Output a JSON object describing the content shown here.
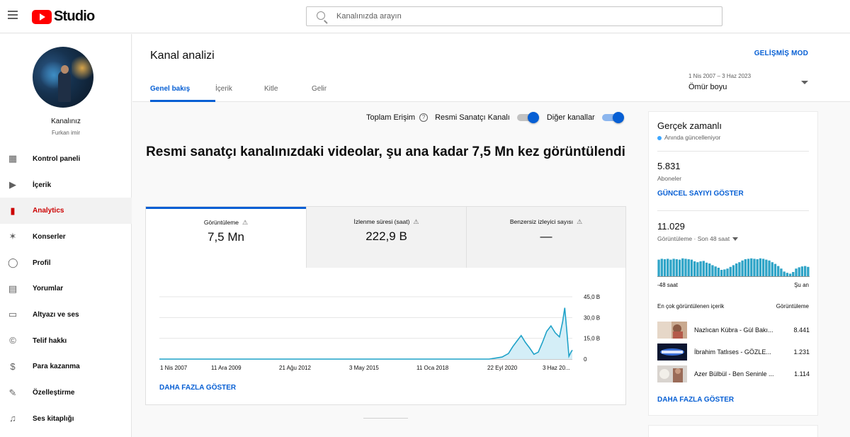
{
  "header": {
    "logo_text": "Studio",
    "search_placeholder": "Kanalınızda arayın"
  },
  "sidebar": {
    "channel_label": "Kanalınız",
    "channel_name": "Furkan imir",
    "items": [
      {
        "label": "Kontrol paneli",
        "icon": "dashboard-icon",
        "glyph": "▦"
      },
      {
        "label": "İçerik",
        "icon": "content-icon",
        "glyph": "▶"
      },
      {
        "label": "Analytics",
        "icon": "analytics-icon",
        "glyph": "▮"
      },
      {
        "label": "Konserler",
        "icon": "concerts-icon",
        "glyph": "✶"
      },
      {
        "label": "Profil",
        "icon": "profile-icon",
        "glyph": "◯"
      },
      {
        "label": "Yorumlar",
        "icon": "comments-icon",
        "glyph": "▤"
      },
      {
        "label": "Altyazı ve ses",
        "icon": "subtitles-icon",
        "glyph": "▭"
      },
      {
        "label": "Telif hakkı",
        "icon": "copyright-icon",
        "glyph": "©"
      },
      {
        "label": "Para kazanma",
        "icon": "monetization-icon",
        "glyph": "$"
      },
      {
        "label": "Özelleştirme",
        "icon": "customization-icon",
        "glyph": "✎"
      },
      {
        "label": "Ses kitaplığı",
        "icon": "audio-library-icon",
        "glyph": "♫"
      }
    ]
  },
  "main": {
    "title": "Kanal analizi",
    "advanced_mode": "GELİŞMİŞ MOD",
    "tabs": [
      {
        "label": "Genel bakış"
      },
      {
        "label": "İçerik"
      },
      {
        "label": "Kitle"
      },
      {
        "label": "Gelir"
      }
    ],
    "date_range": "1 Nis 2007 – 3 Haz 2023",
    "date_label": "Ömür boyu",
    "toggles": {
      "total_reach": "Toplam Erişim",
      "official_artist": "Resmi Sanatçı Kanalı",
      "other_channels": "Diğer kanallar"
    },
    "headline": "Resmi sanatçı kanalınızdaki videolar, şu ana kadar 7,5 Mn kez görüntülendi",
    "metrics": [
      {
        "label": "Görüntüleme",
        "value": "7,5 Mn"
      },
      {
        "label": "İzlenme süresi (saat)",
        "value": "222,9 B"
      },
      {
        "label": "Benzersiz izleyici sayısı",
        "value": "—"
      }
    ],
    "show_more": "DAHA FAZLA GÖSTER"
  },
  "chart_data": {
    "type": "area",
    "x_tick_labels": [
      "1 Nis 2007",
      "11 Ara 2009",
      "21 Ağu 2012",
      "3 May 2015",
      "11 Oca 2018",
      "22 Eyl 2020",
      "3 Haz 20..."
    ],
    "y_tick_labels": [
      "45,0 B",
      "30,0 B",
      "15,0 B",
      "0"
    ],
    "ylim": [
      0,
      45000
    ],
    "grid": true,
    "x_start": "2007-04-01",
    "x_end": "2023-06-03",
    "x": [
      "2020-03-01",
      "2020-06-01",
      "2020-09-01",
      "2020-12-01",
      "2021-02-01",
      "2021-04-01",
      "2021-06-01",
      "2021-08-01",
      "2021-10-01",
      "2021-12-01",
      "2022-02-01",
      "2022-04-01",
      "2022-06-01",
      "2022-08-01",
      "2022-10-01",
      "2022-12-01",
      "2023-01-15",
      "2023-02-15",
      "2023-03-15",
      "2023-04-15",
      "2023-05-15",
      "2023-06-03"
    ],
    "values": [
      0,
      700,
      1500,
      4000,
      9000,
      13000,
      17000,
      12000,
      8000,
      3500,
      5000,
      12000,
      20000,
      24000,
      19000,
      16000,
      27000,
      37000,
      21000,
      2000,
      5000,
      6500
    ]
  },
  "realtime": {
    "title": "Gerçek zamanlı",
    "subtitle": "Anında güncelleniyor",
    "subs_value": "5.831",
    "subs_label": "Aboneler",
    "subs_link": "GÜNCEL SAYIYI GÖSTER",
    "views_value": "11.029",
    "views_label": "Görüntüleme · Son 48 saat",
    "bars": [
      0.78,
      0.82,
      0.8,
      0.82,
      0.78,
      0.82,
      0.8,
      0.78,
      0.84,
      0.82,
      0.8,
      0.78,
      0.7,
      0.66,
      0.7,
      0.72,
      0.64,
      0.6,
      0.52,
      0.46,
      0.4,
      0.3,
      0.32,
      0.36,
      0.44,
      0.52,
      0.6,
      0.66,
      0.74,
      0.8,
      0.82,
      0.84,
      0.82,
      0.8,
      0.84,
      0.82,
      0.78,
      0.74,
      0.66,
      0.58,
      0.48,
      0.36,
      0.22,
      0.16,
      0.12,
      0.2,
      0.36,
      0.42,
      0.46,
      0.48,
      0.44
    ],
    "bars_left": "-48 saat",
    "bars_right": "Şu an",
    "top_header_left": "En çok görüntülenen içerik",
    "top_header_right": "Görüntüleme",
    "top_items": [
      {
        "title": "Nazlıcan Kübra - Gül Bakı...",
        "views": "8.441"
      },
      {
        "title": "İbrahim Tatlıses - GÖZLE...",
        "views": "1.231"
      },
      {
        "title": "Azer Bülbül - Ben Seninle ...",
        "views": "1.114"
      }
    ],
    "show_more": "DAHA FAZLA GÖSTER"
  },
  "colors": {
    "accent": "#065fd4",
    "active_red": "#cc0000",
    "chart_line": "#1fa2c8",
    "chart_fill": "#d4eef7"
  }
}
